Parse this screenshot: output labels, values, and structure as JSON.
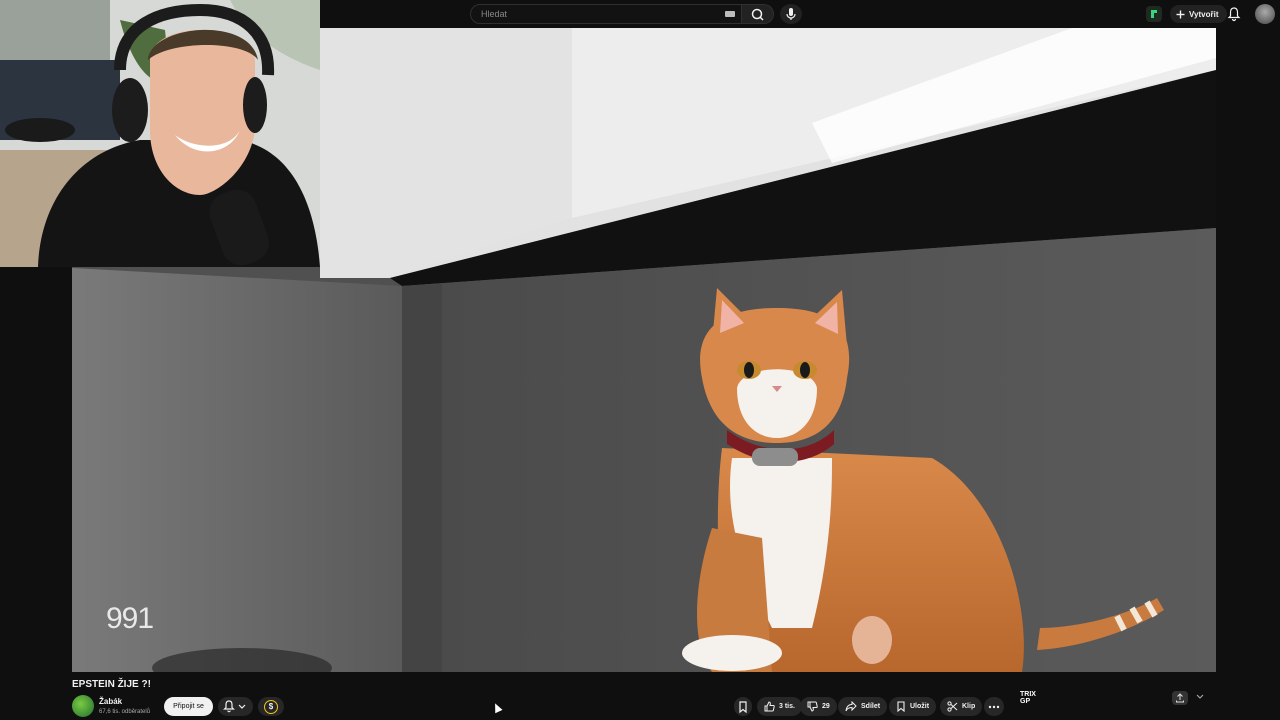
{
  "search": {
    "placeholder": "Hledat"
  },
  "header": {
    "create_label": "Vytvořit"
  },
  "video": {
    "title": "EPSTEIN ŽIJE ?!",
    "overlay_counter": "991"
  },
  "channel": {
    "name": "Žabák",
    "subscribers": "67,6 tis. odběratelů",
    "join_label": "Připojit se",
    "dollar_symbol": "$"
  },
  "actions": {
    "likes": "3 tis.",
    "dislikes": "29",
    "share_label": "Sdílet",
    "save_label": "Uložit",
    "clip_label": "Klip"
  },
  "side_panel": {
    "logo_text": "TRIX\nGP"
  }
}
